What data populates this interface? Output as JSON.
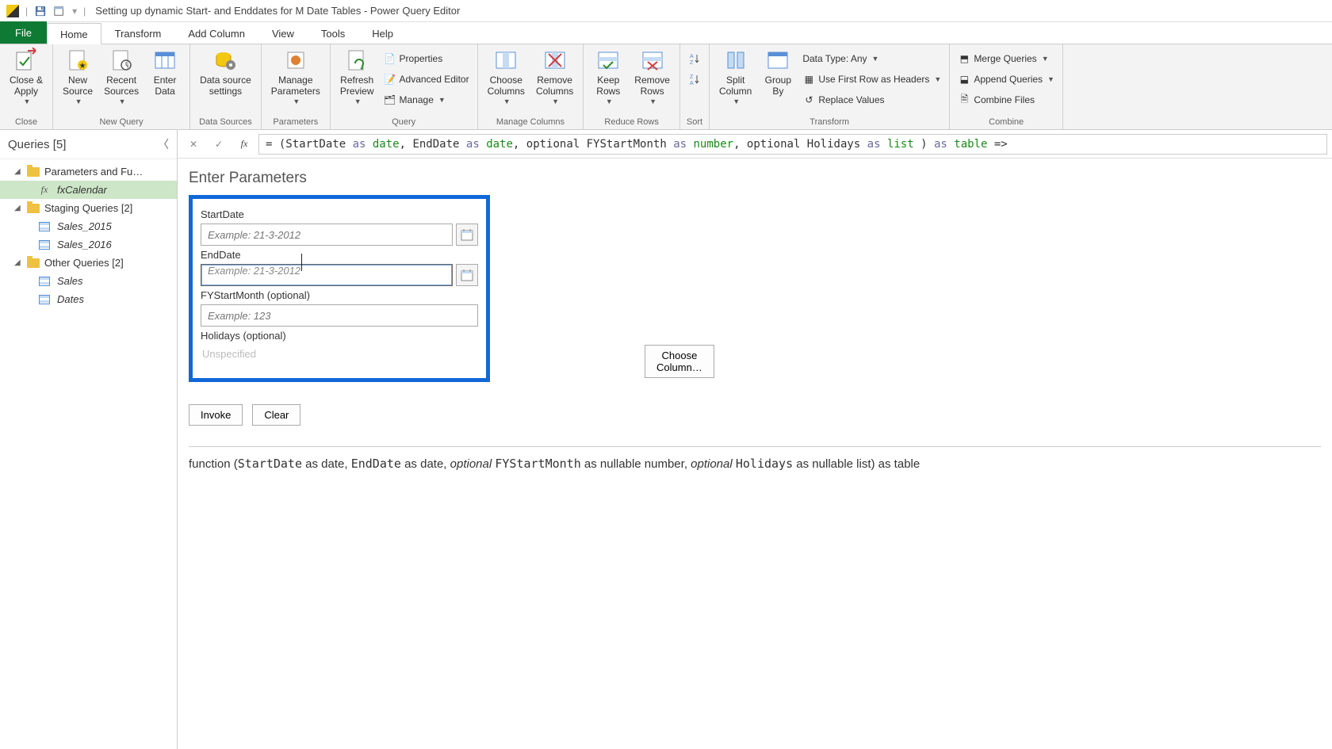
{
  "window": {
    "title": "Setting up dynamic Start- and Enddates for M Date Tables - Power Query Editor"
  },
  "menutabs": {
    "file": "File",
    "home": "Home",
    "transform": "Transform",
    "add_column": "Add Column",
    "view": "View",
    "tools": "Tools",
    "help": "Help"
  },
  "ribbon": {
    "close_group": "Close",
    "close_apply": "Close &\nApply",
    "new_query_group": "New Query",
    "new_source": "New\nSource",
    "recent_sources": "Recent\nSources",
    "enter_data": "Enter\nData",
    "data_sources_group": "Data Sources",
    "data_source_settings": "Data source\nsettings",
    "parameters_group": "Parameters",
    "manage_parameters": "Manage\nParameters",
    "query_group": "Query",
    "refresh_preview": "Refresh\nPreview",
    "properties": "Properties",
    "advanced_editor": "Advanced Editor",
    "manage": "Manage",
    "manage_columns_group": "Manage Columns",
    "choose_columns": "Choose\nColumns",
    "remove_columns": "Remove\nColumns",
    "reduce_rows_group": "Reduce Rows",
    "keep_rows": "Keep\nRows",
    "remove_rows": "Remove\nRows",
    "sort_group": "Sort",
    "transform_group": "Transform",
    "split_column": "Split\nColumn",
    "group_by": "Group\nBy",
    "data_type": "Data Type: Any",
    "first_row_headers": "Use First Row as Headers",
    "replace_values": "Replace Values",
    "combine_group": "Combine",
    "merge_queries": "Merge Queries",
    "append_queries": "Append Queries",
    "combine_files": "Combine Files"
  },
  "sidebar": {
    "header": "Queries [5]",
    "groups": [
      {
        "label": "Parameters and Fu…",
        "items": [
          {
            "label": "fxCalendar",
            "type": "fx",
            "selected": true
          }
        ]
      },
      {
        "label": "Staging Queries [2]",
        "items": [
          {
            "label": "Sales_2015",
            "type": "table"
          },
          {
            "label": "Sales_2016",
            "type": "table"
          }
        ]
      },
      {
        "label": "Other Queries [2]",
        "items": [
          {
            "label": "Sales",
            "type": "table"
          },
          {
            "label": "Dates",
            "type": "table"
          }
        ]
      }
    ]
  },
  "formula": {
    "prefix": "= (StartDate ",
    "as1": "as ",
    "date1": "date",
    "mid1": ", EndDate ",
    "as2": "as ",
    "date2": "date",
    "mid2": ", optional FYStartMonth ",
    "as3": "as ",
    "number": "number",
    "mid3": ", optional Holidays ",
    "as4": "as ",
    "list": "list",
    "mid4": " ) ",
    "as5": "as ",
    "table": "table",
    "arrow": " =>"
  },
  "params": {
    "title": "Enter Parameters",
    "start_label": "StartDate",
    "start_ph": "Example: 21-3-2012",
    "end_label": "EndDate",
    "end_ph": "Example: 21-3-2012",
    "fy_label": "FYStartMonth (optional)",
    "fy_ph": "Example: 123",
    "holidays_label": "Holidays (optional)",
    "holidays_unspecified": "Unspecified",
    "choose_column": "Choose Column…",
    "invoke": "Invoke",
    "clear": "Clear"
  },
  "signature": {
    "pre": "function (",
    "p1": "StartDate",
    "t1": " as date, ",
    "p2": "EndDate",
    "t2": " as date, ",
    "opt1": "optional ",
    "p3": "FYStartMonth",
    "t3": " as nullable number, ",
    "opt2": "optional ",
    "p4": "Holidays",
    "t4": " as nullable list) as table"
  }
}
